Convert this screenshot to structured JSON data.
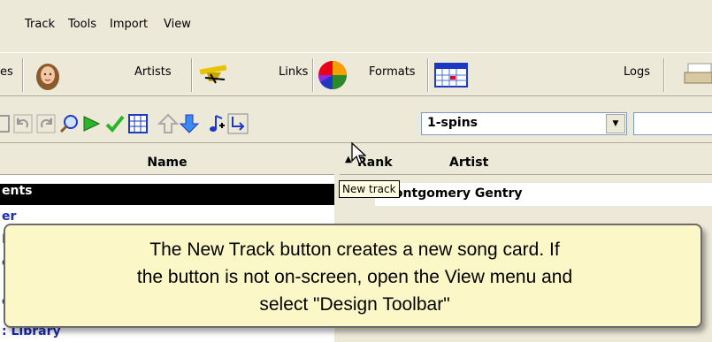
{
  "menu": [
    "Track",
    "Tools",
    "Import",
    "View"
  ],
  "main_toolbar": {
    "partial_label": "es",
    "artists": "Artists",
    "links": "Links",
    "formats": "Formats",
    "logs": "Logs"
  },
  "design_toolbar": {
    "dropdown_value": "1-spins"
  },
  "left_panel": {
    "header": "Name",
    "rows": [
      "ents",
      "er",
      "LF",
      "en",
      "e",
      ": Library"
    ]
  },
  "right_panel": {
    "col_rank": "Rank",
    "col_artist": "Artist",
    "row_rank": "1",
    "row_artist": "Montgomery Gentry"
  },
  "tooltip": "New track",
  "callout": {
    "line1": "The New Track button creates a new song card.  If",
    "line2": "the button is not on-screen, open the View menu and",
    "line3": "select \"Design Toolbar\""
  },
  "colors": {
    "link_blue": "#1a2bb5",
    "toolbar_bg": "#ece9d8",
    "callout_bg": "#fcf7c7",
    "tooltip_bg": "#ffffe1"
  }
}
